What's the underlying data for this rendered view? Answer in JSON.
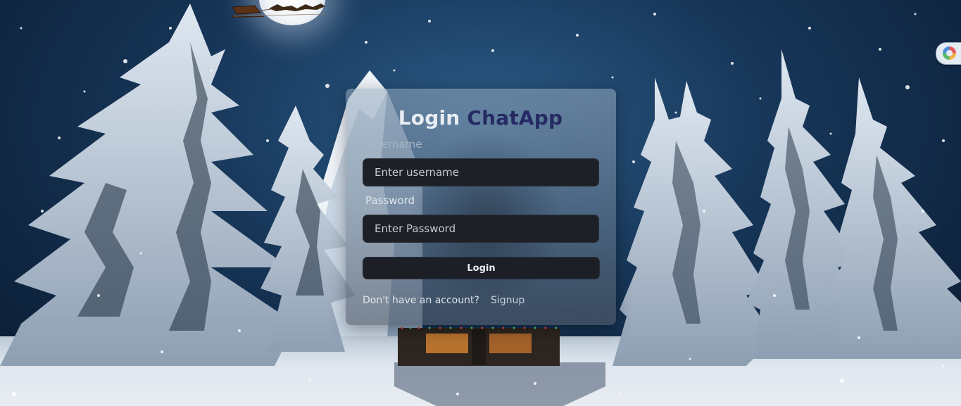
{
  "login": {
    "title_prefix": "Login",
    "title_brand": "ChatApp",
    "username_label": "Username",
    "username_placeholder": "Enter username",
    "password_label": "Password",
    "password_placeholder": "Enter Password",
    "submit_label": "Login",
    "no_account_text": "Don't have an account?",
    "signup_link": "Signup"
  },
  "colors": {
    "brand_title": "#262a63",
    "input_bg": "#1d2027",
    "button_bg": "#1c1f26"
  },
  "extension": {
    "icon": "browser-extension-icon"
  }
}
